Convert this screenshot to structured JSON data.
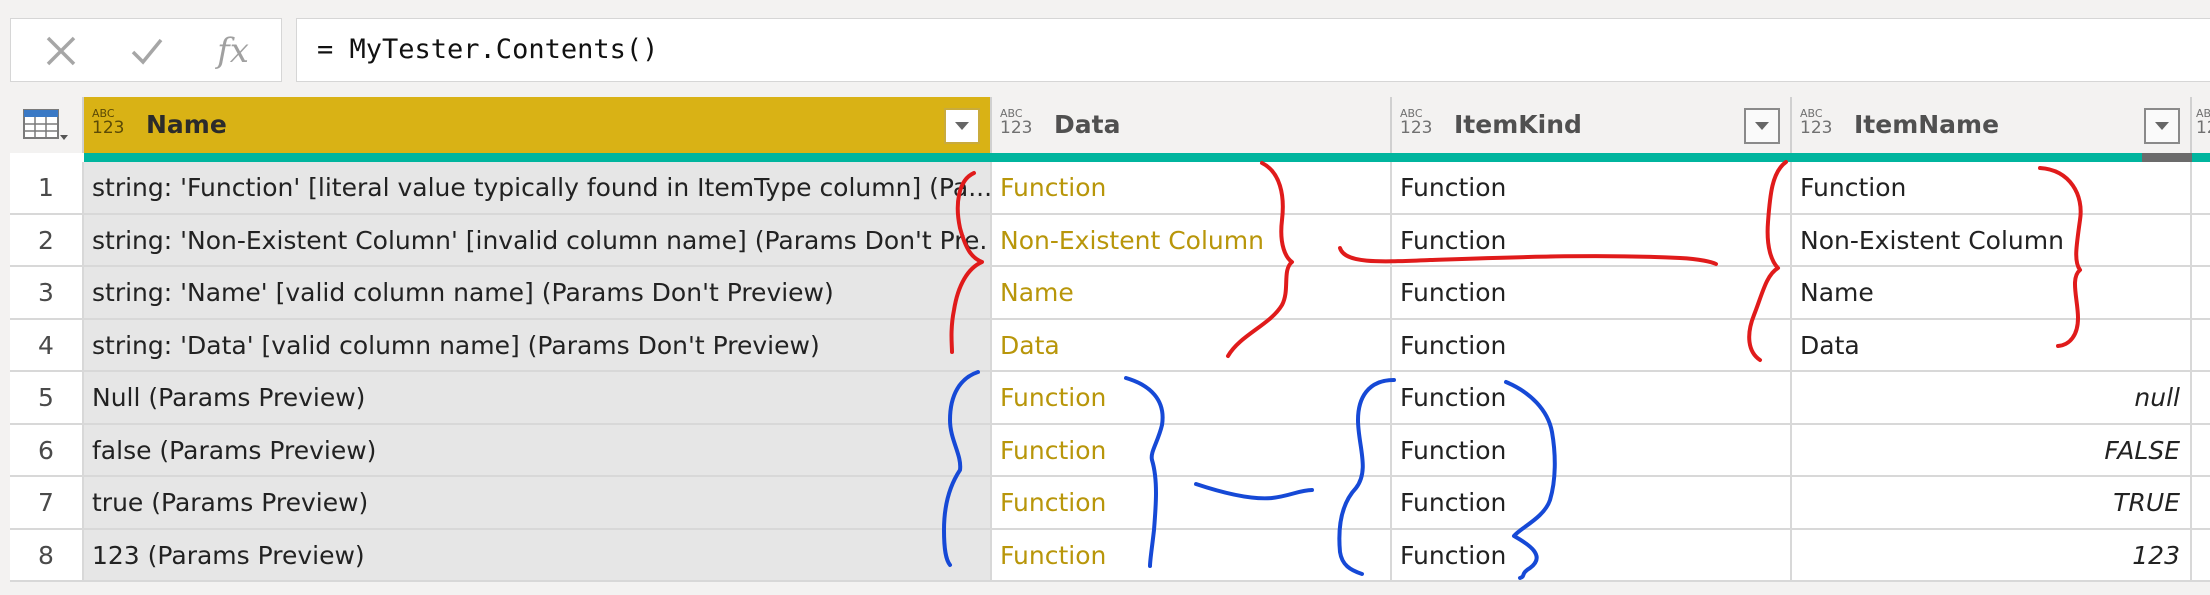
{
  "formula_bar": {
    "cancel_icon": "x-icon",
    "commit_icon": "check-icon",
    "fx_label": "fx",
    "formula": "= MyTester.Contents()"
  },
  "table": {
    "type_icon_top": "ABC",
    "type_icon_bottom": "123",
    "columns": [
      "Name",
      "Data",
      "ItemKind",
      "ItemName"
    ],
    "selected_column": "Name",
    "rows": [
      {
        "num": "1",
        "name": "string: 'Function' [literal value typically found in ItemType column] (Pa...",
        "data": "Function",
        "kind": "Function",
        "item_name": "Function"
      },
      {
        "num": "2",
        "name": "string: 'Non-Existent Column' [invalid column name] (Params Don't Pre...",
        "data": "Non-Existent Column",
        "kind": "Function",
        "item_name": "Non-Existent Column"
      },
      {
        "num": "3",
        "name": "string: 'Name' [valid column name] (Params Don't Preview)",
        "data": "Name",
        "kind": "Function",
        "item_name": "Name"
      },
      {
        "num": "4",
        "name": "string: 'Data' [valid column name] (Params Don't Preview)",
        "data": "Data",
        "kind": "Function",
        "item_name": "Data"
      },
      {
        "num": "5",
        "name": "Null (Params Preview)",
        "data": "Function",
        "kind": "Function",
        "item_name": "null"
      },
      {
        "num": "6",
        "name": "false (Params Preview)",
        "data": "Function",
        "kind": "Function",
        "item_name": "FALSE"
      },
      {
        "num": "7",
        "name": "true (Params Preview)",
        "data": "Function",
        "kind": "Function",
        "item_name": "TRUE"
      },
      {
        "num": "8",
        "name": "123 (Params Preview)",
        "data": "Function",
        "kind": "Function",
        "item_name": "123"
      }
    ]
  },
  "colors": {
    "selected_header": "#d9b215",
    "quality_bar": "#00b59e",
    "data_text": "#b8960a",
    "annotation_red": "#e01b1b",
    "annotation_blue": "#1649d6"
  }
}
